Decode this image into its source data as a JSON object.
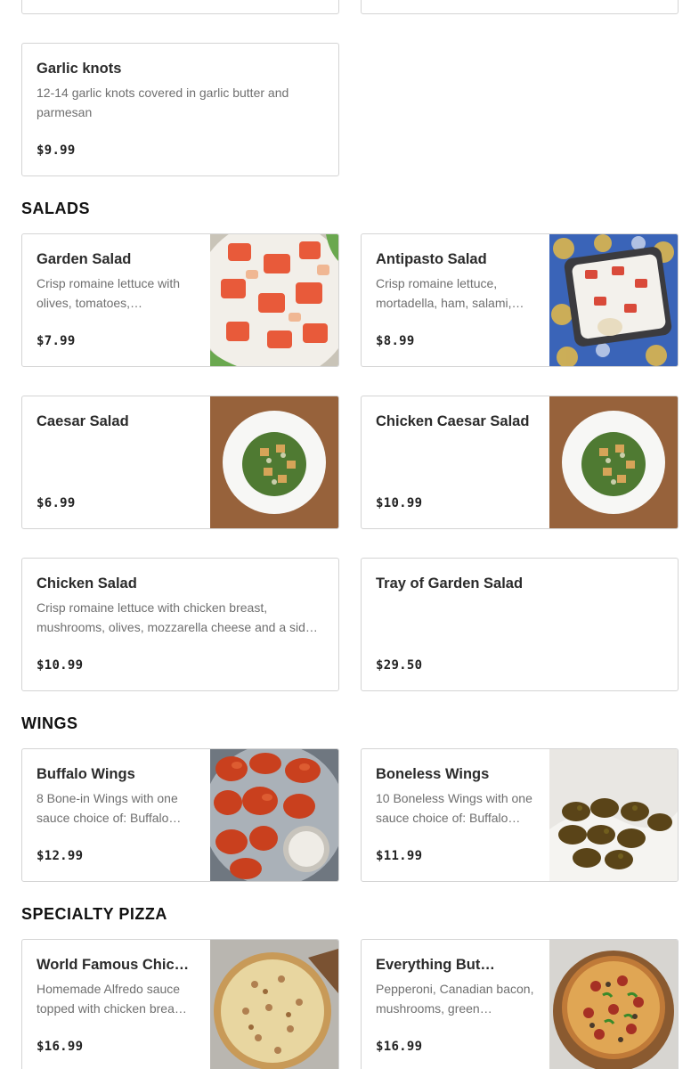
{
  "appetizers": {
    "items": [
      {
        "name": "Garlic knots",
        "description": "12-14 garlic knots covered in garlic butter and parmesan",
        "price": "$9.99"
      }
    ]
  },
  "salads": {
    "title": "SALADS",
    "items": [
      {
        "name": "Garden Salad",
        "description": "Crisp romaine lettuce with olives, tomatoes,…",
        "price": "$7.99",
        "image": "garden-salad-photo"
      },
      {
        "name": "Antipasto Salad",
        "description": "Crisp romaine lettuce, mortadella, ham, salami,…",
        "price": "$8.99",
        "image": "antipasto-salad-photo"
      },
      {
        "name": "Caesar Salad",
        "description": "",
        "price": "$6.99",
        "image": "caesar-salad-photo"
      },
      {
        "name": "Chicken Caesar Salad",
        "description": "",
        "price": "$10.99",
        "image": "chicken-caesar-salad-photo"
      },
      {
        "name": "Chicken Salad",
        "description": "Crisp romaine lettuce with chicken breast, mushrooms, olives, mozzarella cheese and a sid…",
        "price": "$10.99"
      },
      {
        "name": "Tray of Garden Salad",
        "description": "",
        "price": "$29.50"
      }
    ]
  },
  "wings": {
    "title": "WINGS",
    "items": [
      {
        "name": "Buffalo Wings",
        "description": "8 Bone-in Wings with one sauce choice of: Buffalo…",
        "price": "$12.99",
        "image": "buffalo-wings-photo"
      },
      {
        "name": "Boneless Wings",
        "description": "10 Boneless Wings with one sauce choice of: Buffalo…",
        "price": "$11.99",
        "image": "boneless-wings-photo"
      }
    ]
  },
  "specialty_pizza": {
    "title": "SPECIALTY PIZZA",
    "items": [
      {
        "name": "World Famous Chicke…",
        "description": "Homemade Alfredo sauce topped with chicken brea…",
        "price": "$16.99",
        "image": "chicken-alfredo-pizza-photo"
      },
      {
        "name": "Everything But…",
        "description": "Pepperoni, Canadian bacon, mushrooms, green…",
        "price": "$16.99",
        "image": "everything-pizza-photo"
      }
    ]
  }
}
